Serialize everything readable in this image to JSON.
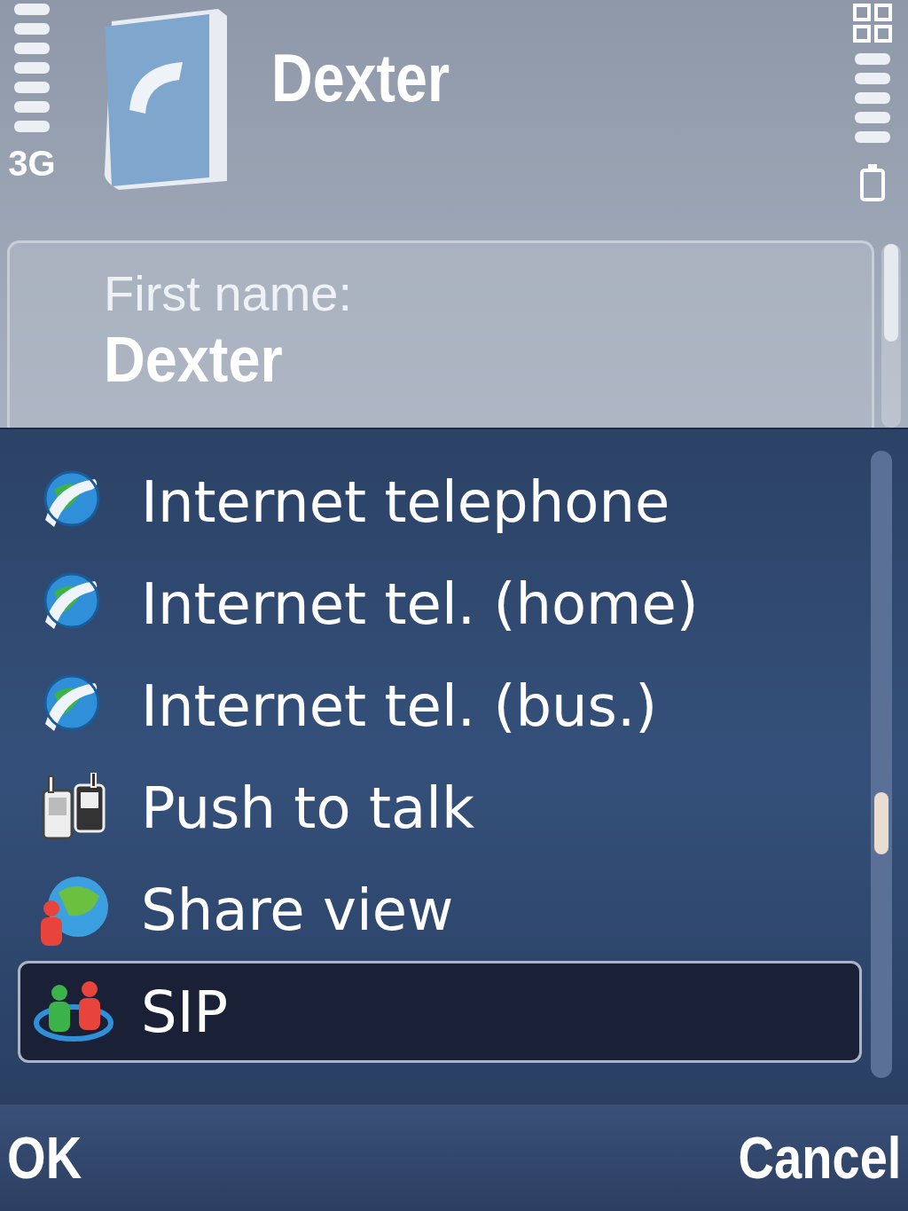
{
  "status": {
    "network": "3G"
  },
  "header": {
    "title": "Dexter"
  },
  "field": {
    "label": "First name:",
    "value": "Dexter"
  },
  "menu": {
    "items": [
      {
        "label": "Internet telephone",
        "kind": "voip",
        "selected": false
      },
      {
        "label": "Internet tel. (home)",
        "kind": "voip",
        "selected": false
      },
      {
        "label": "Internet tel. (bus.)",
        "kind": "voip",
        "selected": false
      },
      {
        "label": "Push to talk",
        "kind": "ptt",
        "selected": false
      },
      {
        "label": "Share view",
        "kind": "share",
        "selected": false
      },
      {
        "label": "SIP",
        "kind": "sip",
        "selected": true
      }
    ]
  },
  "softkeys": {
    "left": "OK",
    "right": "Cancel"
  }
}
